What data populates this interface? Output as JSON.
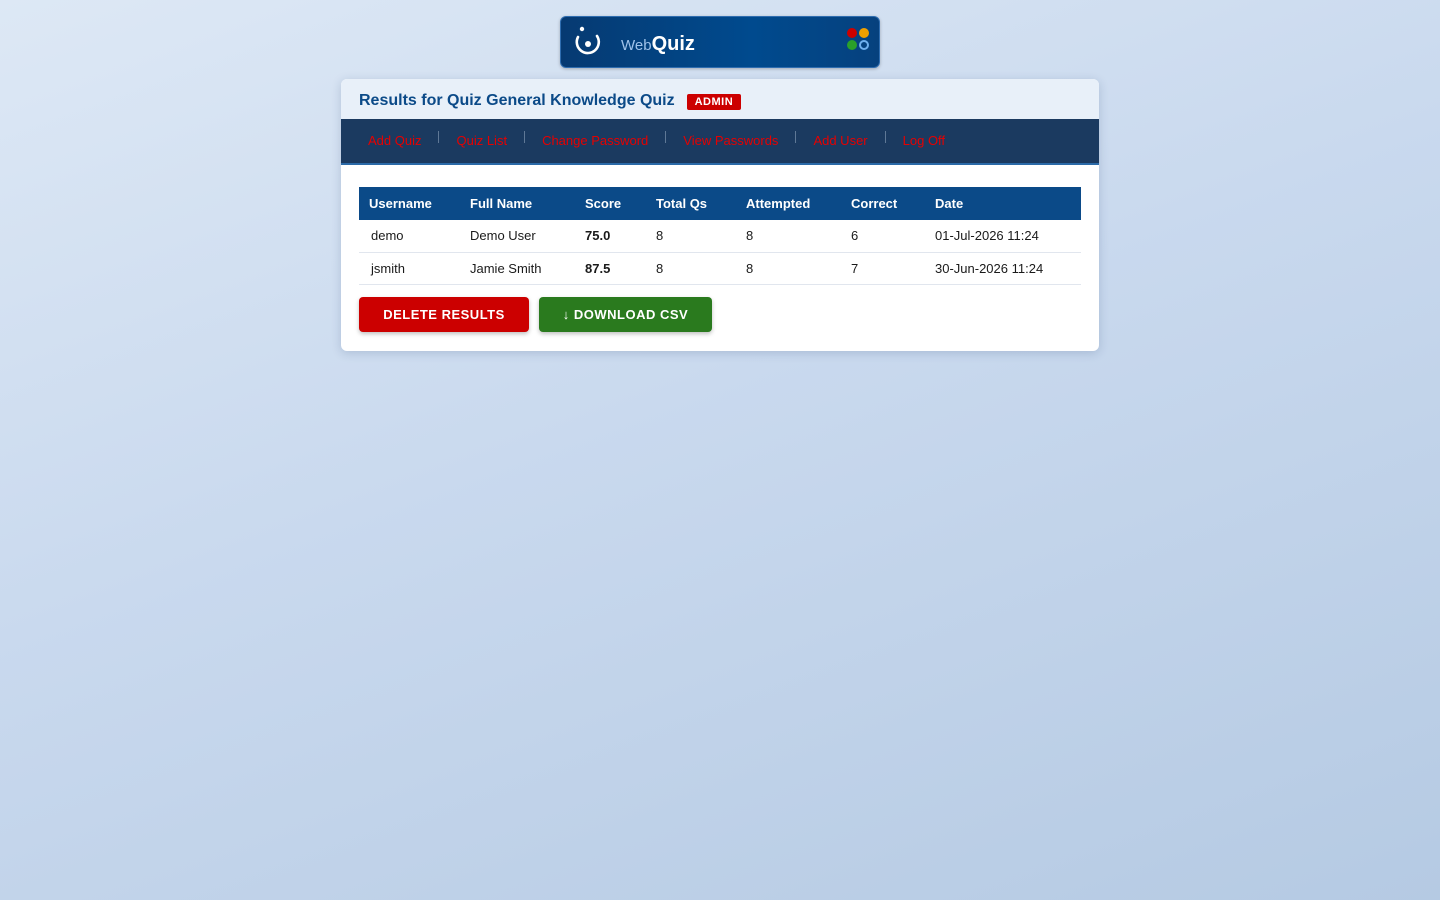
{
  "brand": {
    "web": "Web",
    "quiz": "Quiz",
    "logo_icon": "power-swirl-icon",
    "dot_colors": [
      "#cc0000",
      "#f0a000",
      "#2aa02a",
      "#1d6fc4"
    ]
  },
  "header": {
    "title": "Results for Quiz General Knowledge Quiz",
    "badge": "ADMIN"
  },
  "nav": {
    "items": [
      "Add Quiz",
      "Quiz List",
      "Change Password",
      "View Passwords",
      "Add User",
      "Log Off"
    ]
  },
  "results": {
    "columns": [
      "Username",
      "Full Name",
      "Score",
      "Total Qs",
      "Attempted",
      "Correct",
      "Date"
    ],
    "rows": [
      [
        "demo",
        "Demo User",
        "75.0",
        "8",
        "8",
        "6",
        "01-Jul-2026 11:24"
      ],
      [
        "jsmith",
        "Jamie Smith",
        "87.5",
        "8",
        "8",
        "7",
        "30-Jun-2026 11:24"
      ]
    ]
  },
  "actions": {
    "delete_label": "DELETE RESULTS",
    "csv_label": "↓ DOWNLOAD CSV"
  },
  "colors": {
    "accent": "#0b4a88",
    "nav_bg": "#1b3a60",
    "danger": "#cc0000",
    "success": "#2a7a1e"
  }
}
